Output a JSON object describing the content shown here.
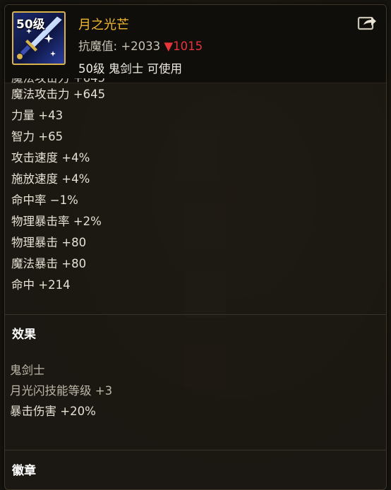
{
  "item": {
    "level_badge": "50级",
    "name": "月之光芒",
    "anti_magic_label": "抗魔值:",
    "anti_magic_value": "+2033",
    "anti_magic_down_arrow": "▼",
    "anti_magic_down_value": "1015",
    "requirement": "50级 鬼剑士 可使用",
    "icon": "blue-sword-icon"
  },
  "stats": [
    "魔法攻击力 +645",
    "力量 +43",
    "智力 +65",
    "攻击速度 +4%",
    "施放速度 +4%",
    "命中率 −1%",
    "物理暴击率 +2%",
    "物理暴击 +80",
    "魔法暴击 +80",
    "命中 +214"
  ],
  "effects": {
    "title": "效果",
    "lines": [
      "鬼剑士",
      "月光闪技能等级 +3",
      "暴击伤害 +20%"
    ]
  },
  "emblem": {
    "title": "徽章"
  },
  "colors": {
    "item_name": "#f0b830",
    "down_value": "#e8343a",
    "icon_border": "#d8b24a"
  }
}
